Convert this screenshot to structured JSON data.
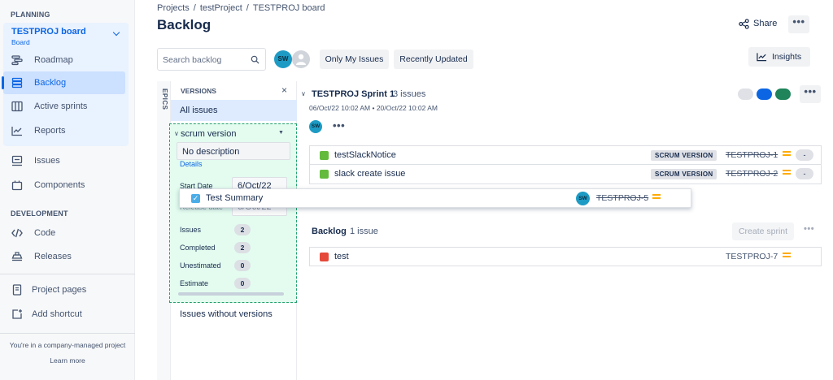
{
  "sidebar": {
    "planning_heading": "PLANNING",
    "board": {
      "title": "TESTPROJ board",
      "subtitle": "Board"
    },
    "planning_items": [
      {
        "label": "Roadmap",
        "icon": "roadmap-icon"
      },
      {
        "label": "Backlog",
        "icon": "backlog-icon",
        "active": true
      },
      {
        "label": "Active sprints",
        "icon": "active-sprints-icon"
      },
      {
        "label": "Reports",
        "icon": "reports-icon"
      }
    ],
    "other_items": [
      {
        "label": "Issues",
        "icon": "issues-icon"
      },
      {
        "label": "Components",
        "icon": "components-icon"
      }
    ],
    "development_heading": "DEVELOPMENT",
    "development_items": [
      {
        "label": "Code",
        "icon": "code-icon"
      },
      {
        "label": "Releases",
        "icon": "releases-icon"
      }
    ],
    "bottom_items": [
      {
        "label": "Project pages",
        "icon": "project-pages-icon"
      },
      {
        "label": "Add shortcut",
        "icon": "add-shortcut-icon"
      }
    ],
    "footer_text": "You're in a company-managed project",
    "footer_link": "Learn more"
  },
  "header": {
    "breadcrumbs": [
      "Projects",
      "testProject",
      "TESTPROJ board"
    ],
    "title": "Backlog",
    "share_label": "Share",
    "more_label": "•••"
  },
  "toolbar": {
    "search_placeholder": "Search backlog",
    "avatar_initials": "SW",
    "only_my_issues": "Only My Issues",
    "recently_updated": "Recently Updated",
    "insights": "Insights"
  },
  "versions_panel": {
    "epics_label": "EPICS",
    "title": "VERSIONS",
    "close": "×",
    "all_issues": "All issues",
    "version": {
      "name": "scrum version",
      "description": "No description",
      "details_link": "Details",
      "start_date_label": "Start Date",
      "start_date": "6/Oct/22",
      "release_date_label": "Release date",
      "release_date": "6/Oct/22",
      "stats": [
        {
          "label": "Issues",
          "value": "2"
        },
        {
          "label": "Completed",
          "value": "2"
        },
        {
          "label": "Unestimated",
          "value": "0"
        },
        {
          "label": "Estimate",
          "value": "0"
        }
      ]
    },
    "issues_without_versions": "Issues without versions"
  },
  "sprint": {
    "title": "TESTPROJ Sprint 1",
    "count": "3 issues",
    "dates": "06/Oct/22 10:02 AM  •  20/Oct/22 10:02 AM",
    "avatar": "SW",
    "more": "•••",
    "status_colors": [
      "#dfe1e6",
      "#0c66e4",
      "#1f845a"
    ],
    "issues": [
      {
        "summary": "testSlackNotice",
        "version": "SCRUM VERSION",
        "key": "TESTPROJ-1",
        "estimate": "-"
      },
      {
        "summary": "slack create issue",
        "version": "SCRUM VERSION",
        "key": "TESTPROJ-2",
        "estimate": "-"
      }
    ]
  },
  "dragged_issue": {
    "summary": "Test Summary",
    "avatar": "SW",
    "key": "TESTPROJ-5"
  },
  "backlog": {
    "title": "Backlog",
    "count": "1 issue",
    "create_sprint": "Create sprint",
    "more": "•••",
    "issues": [
      {
        "summary": "test",
        "key": "TESTPROJ-7"
      }
    ]
  }
}
